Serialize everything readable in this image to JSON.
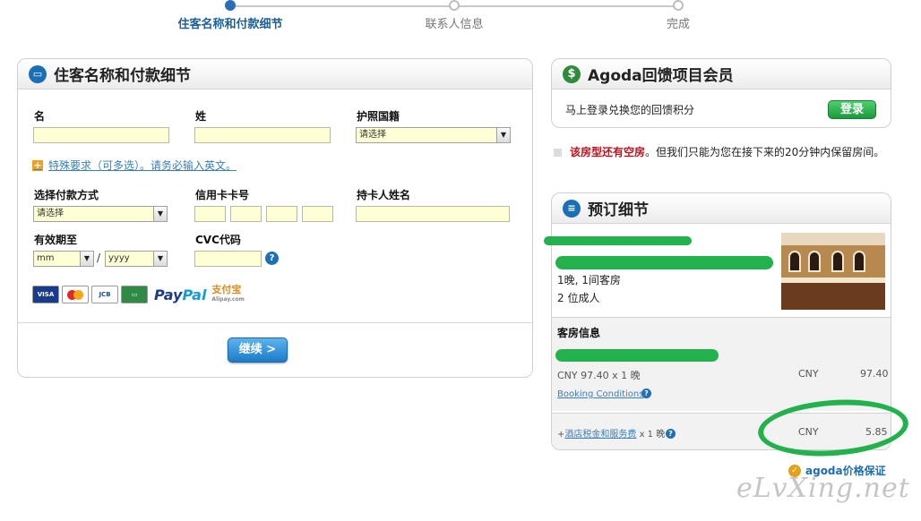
{
  "steps": [
    {
      "label": "住客名称和付款细节",
      "active": true
    },
    {
      "label": "联系人信息",
      "active": false
    },
    {
      "label": "完成",
      "active": false
    }
  ],
  "form": {
    "title": "住客名称和付款细节",
    "first_name_label": "名",
    "last_name_label": "姓",
    "nationality_label": "护照国籍",
    "nationality_value": "请选择",
    "special_request_link": "特殊要求（可多选）。请务必输入英文。",
    "payment_method_label": "选择付款方式",
    "payment_method_value": "请选择",
    "card_number_label": "信用卡卡号",
    "cardholder_label": "持卡人姓名",
    "expiry_label": "有效期至",
    "expiry_month": "mm",
    "expiry_separator": "/",
    "expiry_year": "yyyy",
    "cvc_label": "CVC代码",
    "cards": {
      "visa": "VISA",
      "jcb": "JCB",
      "paypal_a": "Pay",
      "paypal_b": "Pal",
      "alipay": "支付宝",
      "alipay_url": "Alipay.com"
    },
    "continue_label": "继续 >"
  },
  "rewards": {
    "title": "Agoda回馈项目会员",
    "text": "马上登录兑换您的回馈积分",
    "login_label": "登录"
  },
  "notice": {
    "highlight": "该房型还有空房",
    "text": "。但我们只能为您在接下来的20分钟内保留房间。"
  },
  "booking": {
    "title": "预订细节",
    "nights_rooms": "1晚, 1间客房",
    "adults": "2 位成人",
    "room_info_label": "客房信息",
    "rate_line": "CNY 97.40 x 1 晚",
    "rate_currency": "CNY",
    "rate_amount": "97.40",
    "booking_conditions": "Booking Conditions",
    "tax_prefix": "+",
    "tax_link": "酒店税金和服务费",
    "tax_suffix": " x 1 晚",
    "tax_currency": "CNY",
    "tax_amount": "5.85"
  },
  "guarantee": "agoda价格保证",
  "watermark": "eLvXing.net"
}
